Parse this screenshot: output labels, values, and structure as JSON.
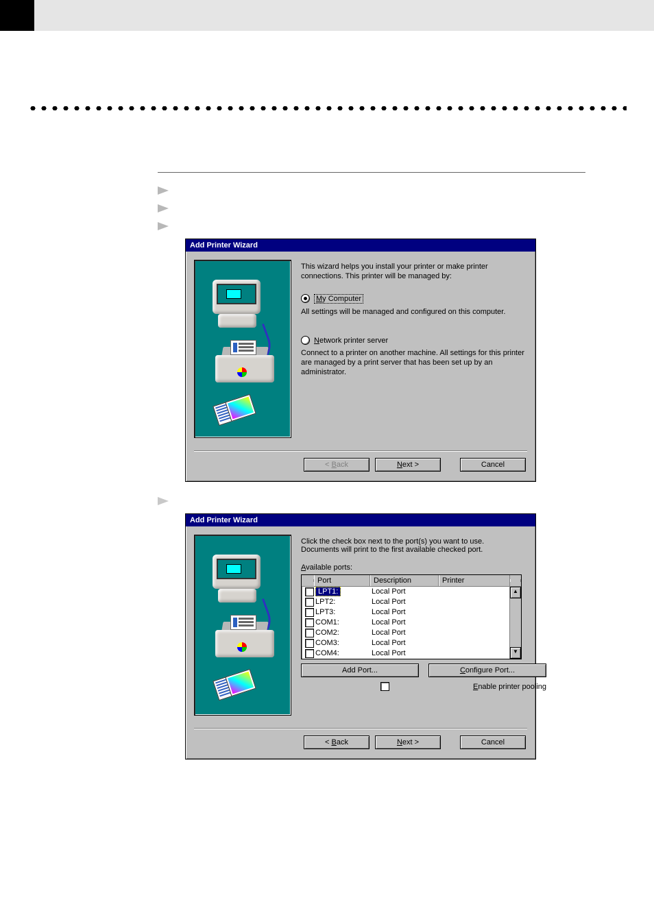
{
  "dialog1": {
    "title": "Add Printer Wizard",
    "intro": "This wizard helps you install your printer or make printer connections.  This printer will be managed by:",
    "option1_prefix": "M",
    "option1_rest": "y Computer",
    "option1_desc": "All settings will be managed and configured on this computer.",
    "option2_prefix": "N",
    "option2_label": "etwork printer server",
    "option2_desc": "Connect to a printer on another machine.  All settings for this printer are managed by a print server that has been set up by an administrator.",
    "back_u": "B",
    "back_rest": "ack",
    "next_u": "N",
    "next_rest": "ext >",
    "cancel": "Cancel"
  },
  "dialog2": {
    "title": "Add Printer Wizard",
    "intro1": "Click the check box next to the port(s) you want to use.",
    "intro2": "Documents will print to the first available checked port.",
    "ports_label_u": "A",
    "ports_label_rest": "vailable ports:",
    "col_port": "Port",
    "col_desc": "Description",
    "col_printer": "Printer",
    "ports": [
      {
        "name": "LPT1:",
        "desc": "Local Port",
        "selected": true
      },
      {
        "name": "LPT2:",
        "desc": "Local Port"
      },
      {
        "name": "LPT3:",
        "desc": "Local Port"
      },
      {
        "name": "COM1:",
        "desc": "Local Port"
      },
      {
        "name": "COM2:",
        "desc": "Local Port"
      },
      {
        "name": "COM3:",
        "desc": "Local Port"
      },
      {
        "name": "COM4:",
        "desc": "Local Port"
      }
    ],
    "add_port": "Add Port...",
    "configure_port_u": "C",
    "configure_port_rest": "onfigure Port...",
    "enable_pool_u": "E",
    "enable_pool_rest": "nable printer pooling",
    "back_pre": "< ",
    "back_u": "B",
    "back_rest": "ack",
    "next_u": "N",
    "next_rest": "ext >",
    "cancel": "Cancel",
    "scroll_up": "▲",
    "scroll_down": "▼"
  }
}
